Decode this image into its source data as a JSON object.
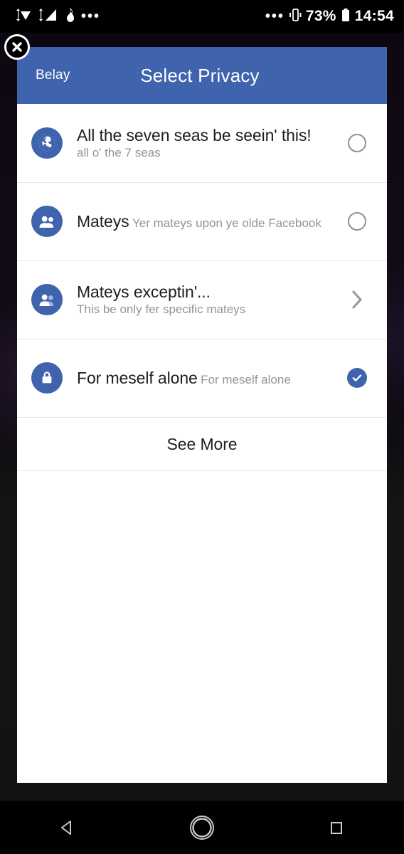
{
  "status_bar": {
    "left_icons": [
      "wifi-icon",
      "signal-icon",
      "tinder-flame-icon",
      "overflow-dots-icon"
    ],
    "right_dots": "•••",
    "vibrate_icon": "vibrate-icon",
    "battery_percent": "73%",
    "battery_icon": "battery-icon",
    "time": "14:54"
  },
  "close_button": {
    "label": "close-icon"
  },
  "app_bar": {
    "cancel_label": "Belay",
    "title": "Select Privacy",
    "background_color": "#3F63AD"
  },
  "options": [
    {
      "icon": "globe-icon",
      "title": "All the seven seas be seein' this!",
      "subtitle": "all o' the 7 seas",
      "trailing": "radio-off",
      "selected": false
    },
    {
      "icon": "friends-icon",
      "title": "Mateys",
      "subtitle": "Yer mateys upon ye olde Facebook",
      "trailing": "radio-off",
      "selected": false
    },
    {
      "icon": "friends-except-icon",
      "title": "Mateys exceptin'...",
      "subtitle": "This be only fer specific mateys",
      "trailing": "chevron-right",
      "selected": false
    },
    {
      "icon": "lock-icon",
      "title": "For meself alone",
      "subtitle": "For meself alone",
      "trailing": "check-selected",
      "selected": true
    }
  ],
  "see_more": {
    "label": "See More"
  },
  "nav_bar": {
    "back": "back-triangle-icon",
    "home": "home-circle-icon",
    "recents": "recents-square-icon"
  },
  "colors": {
    "accent": "#3F63AD",
    "title_text": "#1c1e21",
    "subtitle_text": "#90949c",
    "divider": "#e3e5e8",
    "dialog_bg": "#ffffff"
  }
}
